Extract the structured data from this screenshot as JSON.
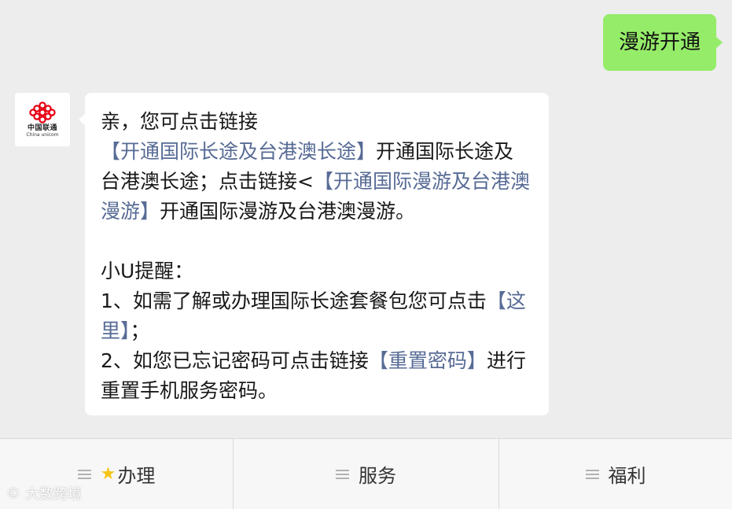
{
  "chat": {
    "outgoing": {
      "text": "漫游开通"
    },
    "avatar": {
      "brand_cn": "中国联通",
      "brand_en": "China unicom"
    },
    "incoming": {
      "p1": {
        "t1": "亲，您可点击链接",
        "link1": "【开通国际长途及台港澳长途】",
        "t2": "开通国际长途及台港澳长途；点击链接<",
        "link2": "【开通国际漫游及台港澳漫游】",
        "t3": "开通国际漫游及台港澳漫游。"
      },
      "reminder_title": "小U提醒：",
      "item1": {
        "t1": "1、如需了解或办理国际长途套餐包您可点击",
        "link": "【这里】",
        "t2": "；"
      },
      "item2": {
        "t1": "2、如您已忘记密码可点击链接",
        "link": "【重置密码】",
        "t2": "进行重置手机服务密码。"
      }
    }
  },
  "menu": {
    "items": [
      {
        "label": "办理",
        "icon": "star-icon"
      },
      {
        "label": "服务"
      },
      {
        "label": "福利"
      }
    ]
  },
  "watermark": {
    "logo": "©",
    "text": "大数跨境"
  },
  "colors": {
    "background": "#ededed",
    "outgoing_bubble": "#95ec69",
    "incoming_bubble": "#ffffff",
    "link": "#576b95",
    "menu_bg": "#f7f7f7",
    "brand_red": "#e60012"
  }
}
